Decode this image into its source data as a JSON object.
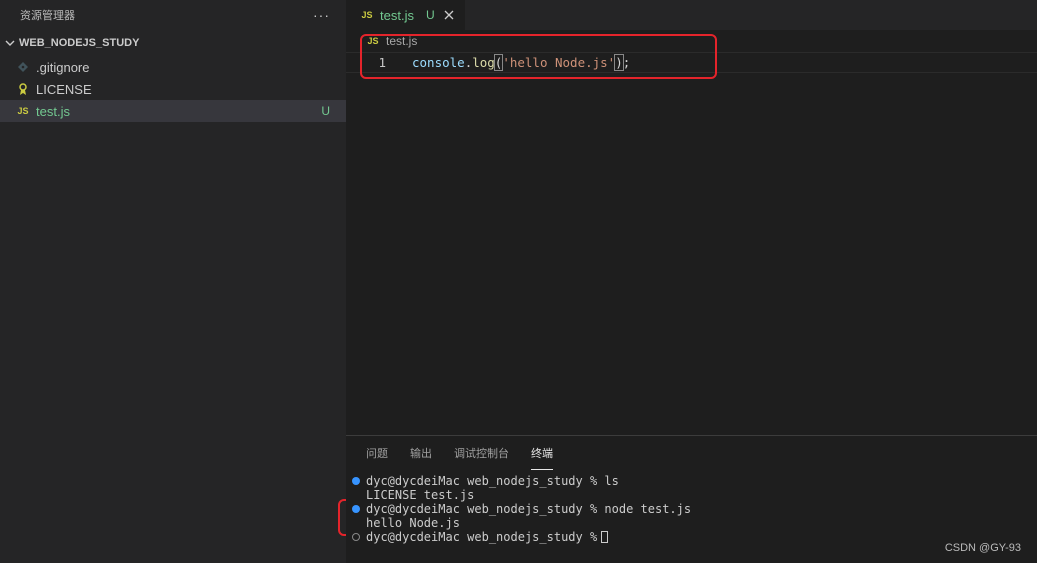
{
  "sidebar": {
    "title": "资源管理器",
    "more": "···",
    "folder": "WEB_NODEJS_STUDY",
    "files": [
      {
        "name": ".gitignore",
        "icon": "git-icon",
        "badge": ""
      },
      {
        "name": "LICENSE",
        "icon": "license-icon",
        "badge": ""
      },
      {
        "name": "test.js",
        "icon": "js-icon",
        "badge": "U"
      }
    ]
  },
  "editor": {
    "tab": {
      "label": "test.js",
      "badge": "U"
    },
    "breadcrumb": "test.js",
    "js_label": "JS",
    "line_number": "1",
    "code": {
      "obj": "console",
      "dot": ".",
      "fn": "log",
      "open": "(",
      "str": "'hello Node.js'",
      "close": ")",
      "semi": ";"
    }
  },
  "panel": {
    "tabs": [
      "问题",
      "输出",
      "调试控制台",
      "终端"
    ],
    "active_tab": "终端",
    "terminal": [
      "dyc@dycdeiMac web_nodejs_study % ls",
      "LICENSE test.js",
      "dyc@dycdeiMac web_nodejs_study % node test.js",
      "hello Node.js",
      "dyc@dycdeiMac web_nodejs_study %"
    ]
  },
  "watermark": "CSDN @GY-93",
  "colors": {
    "accent": "#3794ff",
    "highlight": "#e4242b",
    "untracked": "#73c991"
  }
}
